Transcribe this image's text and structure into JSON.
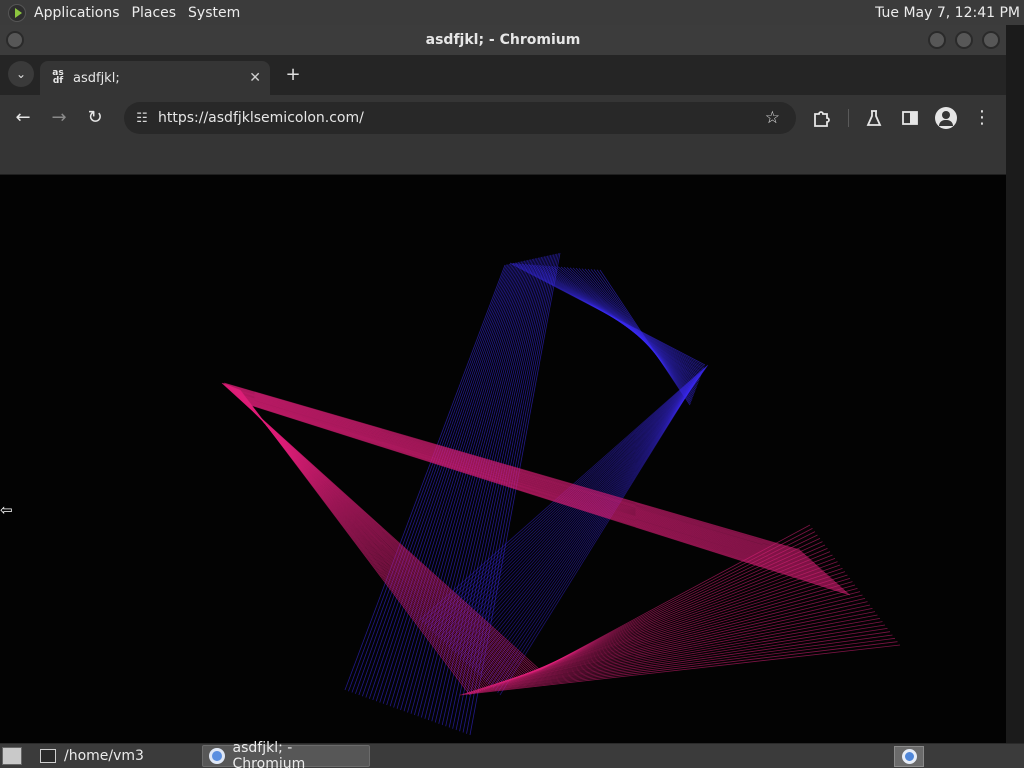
{
  "top_panel": {
    "menus": [
      "Applications",
      "Places",
      "System"
    ],
    "clock": "Tue May  7, 12:41 PM"
  },
  "window": {
    "title": "asdfjkl; - Chromium"
  },
  "tabs": [
    {
      "favicon_text": "as\ndf",
      "title": "asdfjkl;"
    }
  ],
  "toolbar": {
    "back_icon": "arrow-left-icon",
    "forward_icon": "arrow-right-icon",
    "reload_icon": "reload-icon",
    "url": "https://asdfjklsemicolon.com/"
  },
  "taskbar": {
    "tasks": [
      {
        "label": "/home/vm3",
        "icon": "terminal-icon"
      },
      {
        "label": "asdfjkl; - Chromium",
        "icon": "chromium-icon"
      }
    ]
  },
  "colors": {
    "panel": "#3b3b3b",
    "tabstrip": "#252525",
    "toolbar": "#353535",
    "canvas_bg": "#030303",
    "magenta_lines": "#e0207a",
    "blue_lines": "#3b2bf0"
  }
}
